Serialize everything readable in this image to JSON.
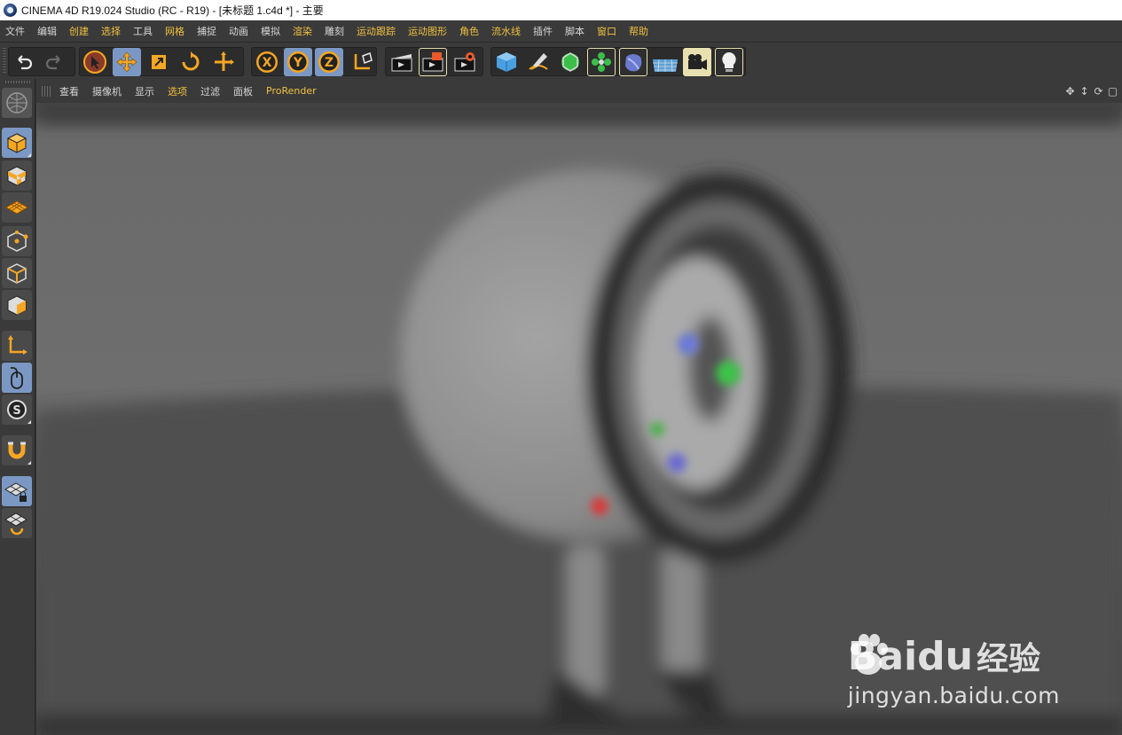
{
  "window": {
    "title": "CINEMA 4D R19.024 Studio (RC - R19) - [未标题 1.c4d *] - 主要"
  },
  "menubar": {
    "items": [
      {
        "label": "文件",
        "accent": false
      },
      {
        "label": "编辑",
        "accent": false
      },
      {
        "label": "创建",
        "accent": true
      },
      {
        "label": "选择",
        "accent": true
      },
      {
        "label": "工具",
        "accent": false
      },
      {
        "label": "网格",
        "accent": true
      },
      {
        "label": "捕捉",
        "accent": false
      },
      {
        "label": "动画",
        "accent": false
      },
      {
        "label": "模拟",
        "accent": false
      },
      {
        "label": "渲染",
        "accent": true
      },
      {
        "label": "雕刻",
        "accent": false
      },
      {
        "label": "运动跟踪",
        "accent": true
      },
      {
        "label": "运动图形",
        "accent": true
      },
      {
        "label": "角色",
        "accent": true
      },
      {
        "label": "流水线",
        "accent": true
      },
      {
        "label": "插件",
        "accent": false
      },
      {
        "label": "脚本",
        "accent": false
      },
      {
        "label": "窗口",
        "accent": true
      },
      {
        "label": "帮助",
        "accent": true
      }
    ]
  },
  "toolbar": {
    "undo": "undo-icon",
    "redo": "redo-icon",
    "axis_x": "X",
    "axis_y": "Y",
    "axis_z": "Z"
  },
  "viewport": {
    "menu": [
      {
        "label": "查看",
        "accent": false
      },
      {
        "label": "摄像机",
        "accent": false
      },
      {
        "label": "显示",
        "accent": false
      },
      {
        "label": "选项",
        "accent": true
      },
      {
        "label": "过滤",
        "accent": false
      },
      {
        "label": "面板",
        "accent": false
      },
      {
        "label": "ProRender",
        "accent": true
      }
    ],
    "nav_icons": [
      "move-view-icon",
      "dolly-view-icon",
      "rotate-view-icon",
      "toggle-view-icon"
    ]
  },
  "watermark": {
    "brand_left": "Bai",
    "brand_right": "du",
    "suffix": "经验",
    "url": "jingyan.baidu.com"
  },
  "colors": {
    "accent_yellow": "#f0c040",
    "active_blue": "#7b98c4",
    "orange_icon": "#f5a623",
    "panel_bg": "#3a3a3a"
  }
}
